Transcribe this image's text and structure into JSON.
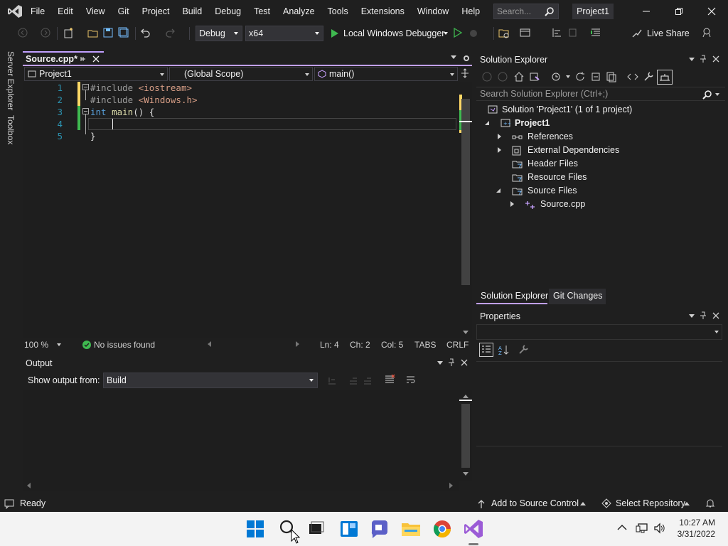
{
  "colors": {
    "accent": "#c1a0ff",
    "background": "#1f1f1f",
    "editor": "#1e1e1e",
    "line_numbers": "#2b91af",
    "keyword": "#569cd6",
    "string": "#d69d85"
  },
  "titlebar": {
    "menu": [
      "File",
      "Edit",
      "View",
      "Git",
      "Project",
      "Build",
      "Debug",
      "Test",
      "Analyze",
      "Tools",
      "Extensions",
      "Window",
      "Help"
    ],
    "search_placeholder": "Search...",
    "project_name": "Project1"
  },
  "toolbar": {
    "configuration": "Debug",
    "platform": "x64",
    "debugger_label": "Local Windows Debugger",
    "live_share_label": "Live Share"
  },
  "side_tabs": [
    "Server Explorer",
    "Toolbox"
  ],
  "editor": {
    "tab_label": "Source.cpp*",
    "nav_project": "Project1",
    "nav_scope": "(Global Scope)",
    "nav_member": "main()",
    "lines": [
      {
        "num": "1",
        "parts": [
          {
            "t": "#include ",
            "c": "pp"
          },
          {
            "t": "<iostream>",
            "c": "str"
          }
        ]
      },
      {
        "num": "2",
        "parts": [
          {
            "t": "#include ",
            "c": "pp"
          },
          {
            "t": "<Windows.h>",
            "c": "str"
          }
        ]
      },
      {
        "num": "3",
        "parts": [
          {
            "t": "int",
            "c": "kw"
          },
          {
            "t": " main",
            "c": "fn"
          },
          {
            "t": "() {",
            "c": ""
          }
        ]
      },
      {
        "num": "4",
        "parts": [
          {
            "t": "    ",
            "c": ""
          }
        ]
      },
      {
        "num": "5",
        "parts": [
          {
            "t": "}",
            "c": ""
          }
        ]
      }
    ],
    "status": {
      "zoom": "100 %",
      "issues": "No issues found",
      "ln": "Ln: 4",
      "ch": "Ch: 2",
      "col": "Col: 5",
      "tabs": "TABS",
      "eol": "CRLF"
    }
  },
  "output": {
    "title": "Output",
    "show_from_label": "Show output from:",
    "source": "Build"
  },
  "solution_explorer": {
    "title": "Solution Explorer",
    "search_placeholder": "Search Solution Explorer (Ctrl+;)",
    "solution_label": "Solution 'Project1' (1 of 1 project)",
    "project": "Project1",
    "items": [
      "References",
      "External Dependencies",
      "Header Files",
      "Resource Files",
      "Source Files"
    ],
    "source_file": "Source.cpp",
    "tabs": [
      "Solution Explorer",
      "Git Changes"
    ]
  },
  "properties": {
    "title": "Properties"
  },
  "statusbar": {
    "ready": "Ready",
    "add_source_control": "Add to Source Control",
    "select_repository": "Select Repository"
  },
  "taskbar": {
    "time": "10:27 AM",
    "date": "3/31/2022"
  }
}
